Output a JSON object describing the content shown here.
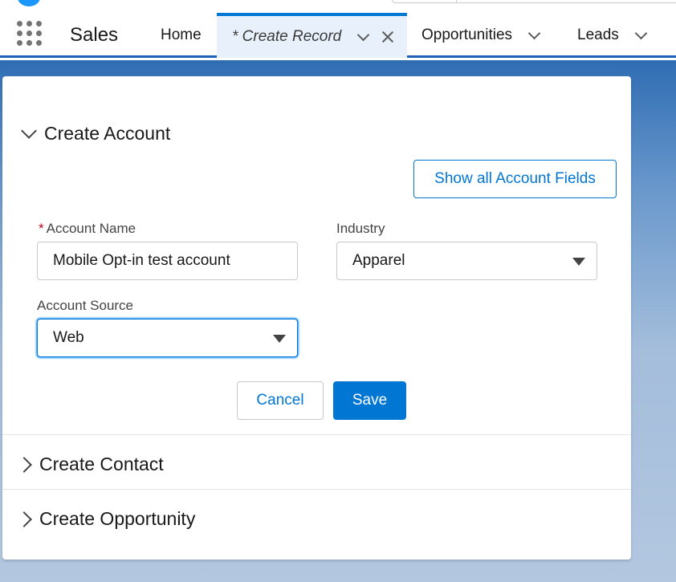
{
  "nav": {
    "app_name": "Sales",
    "items": [
      {
        "label": "Home"
      },
      {
        "label": "* Create Record"
      },
      {
        "label": "Opportunities"
      },
      {
        "label": "Leads"
      }
    ]
  },
  "sections": {
    "account": {
      "title": "Create Account",
      "show_all_button": "Show all Account Fields",
      "fields": {
        "account_name": {
          "label": "Account Name",
          "required_marker": "*",
          "value": "Mobile Opt-in test account"
        },
        "industry": {
          "label": "Industry",
          "value": "Apparel"
        },
        "account_source": {
          "label": "Account Source",
          "value": "Web"
        }
      },
      "cancel_label": "Cancel",
      "save_label": "Save"
    },
    "contact": {
      "title": "Create Contact"
    },
    "opportunity": {
      "title": "Create Opportunity"
    }
  },
  "colors": {
    "brand": "#0176d3",
    "nav_active_bg": "#e8f1fb",
    "required": "#ba0517"
  }
}
